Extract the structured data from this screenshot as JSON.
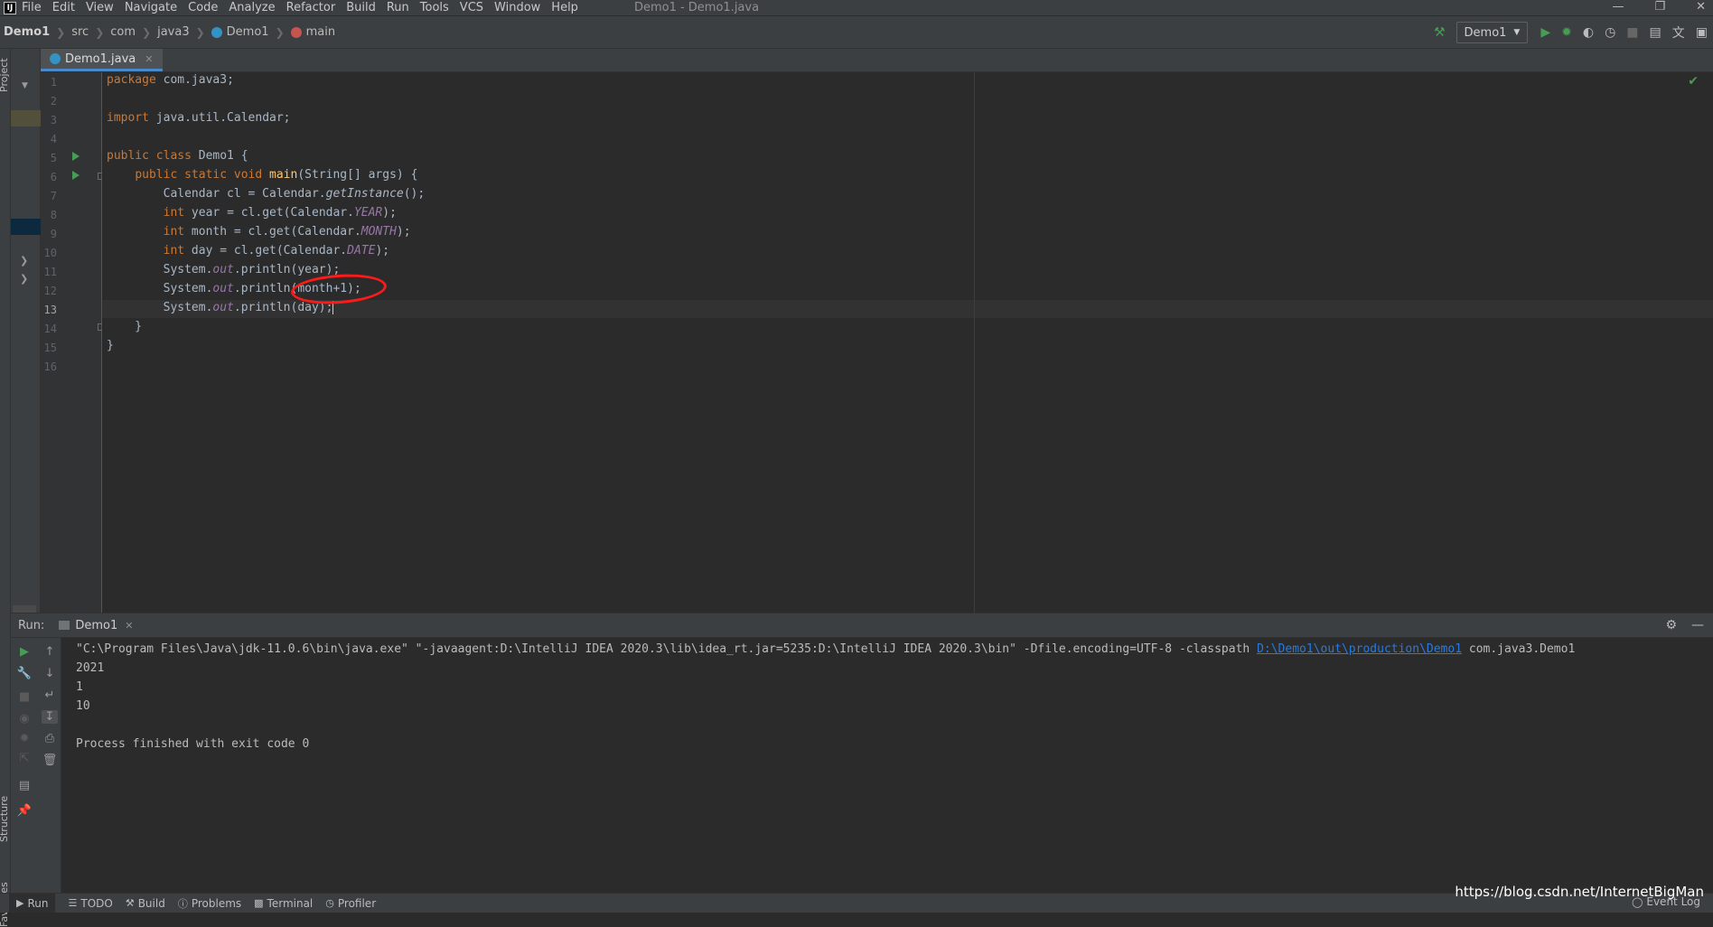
{
  "menubar": {
    "items": [
      "File",
      "Edit",
      "View",
      "Navigate",
      "Code",
      "Analyze",
      "Refactor",
      "Build",
      "Run",
      "Tools",
      "VCS",
      "Window",
      "Help"
    ],
    "window_title": "Demo1 - Demo1.java"
  },
  "breadcrumb": [
    "Demo1",
    "src",
    "com",
    "java3",
    "Demo1",
    "main"
  ],
  "toolbar": {
    "run_config": "Demo1"
  },
  "side_tabs": {
    "project": "Project",
    "structure": "Structure",
    "favorites": "Favorites"
  },
  "editor": {
    "tab_label": "Demo1.java",
    "line_numbers": [
      "1",
      "2",
      "3",
      "4",
      "5",
      "6",
      "7",
      "8",
      "9",
      "10",
      "11",
      "12",
      "13",
      "14",
      "15",
      "16"
    ],
    "current_line": 13
  },
  "run_panel": {
    "title": "Run:",
    "tab": "Demo1",
    "console": {
      "command_prefix": "\"C:\\Program Files\\Java\\jdk-11.0.6\\bin\\java.exe\" \"-javaagent:D:\\IntelliJ IDEA 2020.3\\lib\\idea_rt.jar=5235:D:\\IntelliJ IDEA 2020.3\\bin\" -Dfile.encoding=UTF-8 -classpath ",
      "classpath_link": "D:\\Demo1\\out\\production\\Demo1",
      "command_suffix": " com.java3.Demo1",
      "output": [
        "2021",
        "1",
        "10"
      ],
      "finished": "Process finished with exit code 0"
    }
  },
  "statusbar": {
    "tabs": [
      "Run",
      "TODO",
      "Build",
      "Problems",
      "Terminal",
      "Profiler"
    ],
    "event_log": "Event Log"
  },
  "watermark": "https://blog.csdn.net/InternetBigMan",
  "colors": {
    "accent": "#4a88c7",
    "run_green": "#499c54",
    "annotation_red": "#ff1a1a",
    "keyword": "#cc7832",
    "link": "#287bde"
  }
}
